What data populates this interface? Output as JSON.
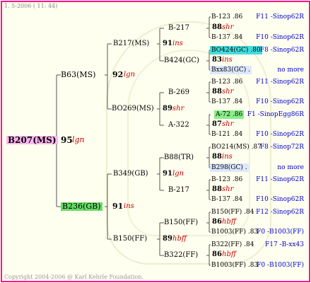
{
  "header": {
    "date": "1.  5-2006 ( 11: 44)"
  },
  "footer": {
    "copyright": "Copyright 2004-2006 @ Karl Kehrle Foundation."
  },
  "colors": {
    "border": "#ff1493",
    "root_bg": "#ffb6f0",
    "gb_bg": "#66dd66",
    "cyan_bg": "#44dddd",
    "green_bg": "#88ee88",
    "light_bg": "#dde8ff"
  },
  "root": {
    "name": "B207(MS)",
    "num": "95",
    "tag": "lgn"
  },
  "g1": {
    "top": {
      "name": "B63(MS)",
      "num": "92",
      "tag": "lgn"
    },
    "bottom": {
      "name": "B236(GB)",
      "num": "91",
      "tag": "ins"
    }
  },
  "g2": {
    "a": {
      "name": "B217(MS)",
      "num": "91",
      "tag": "ins"
    },
    "b": {
      "name": "BO269(MS)",
      "num": "89",
      "tag": "shr"
    },
    "c": {
      "name": "B349(GB)",
      "num": "91",
      "tag": "lgn"
    },
    "d": {
      "name": "B150(FF)",
      "num": "89",
      "tag": "hbff"
    }
  },
  "g3": {
    "a1": {
      "name": "B-217",
      "num": "88",
      "tag": "shr"
    },
    "a2": {
      "name": "B424(GC)",
      "num": "83",
      "tag": "ins"
    },
    "b1": {
      "name": "B-269",
      "num": "88",
      "tag": "shr"
    },
    "b2": {
      "name": "A-322",
      "num": "87",
      "tag": "shr"
    },
    "c1": {
      "name": "B88(TR)",
      "num": "88",
      "tag": "ins"
    },
    "c2": {
      "name": "B-217",
      "num": "88",
      "tag": "shr"
    },
    "d1": {
      "name": "B150(FF)",
      "num": "86",
      "tag": "hbff"
    },
    "d2": {
      "name": "B322(FF)",
      "num": "86",
      "tag": "hbff"
    }
  },
  "g4": [
    {
      "name": "B-123 .86",
      "ped": "F11 -Sinop62R"
    },
    {
      "name": "B-137 .84",
      "ped": "F10 -Sinop62R"
    },
    {
      "name": "BO424(GC) .80",
      "ped": "F8 -Sinop62R"
    },
    {
      "name": "Bxx83(GC) .",
      "ped": "no more"
    },
    {
      "name": "B-123 .86",
      "ped": "F11 -Sinop62R"
    },
    {
      "name": "B-137 .84",
      "ped": "F10 -Sinop62R"
    },
    {
      "name": "A-72 .86",
      "ped": "F1 -SinopEgg86R"
    },
    {
      "name": "B-121 .84",
      "ped": "F10 -Sinop62R"
    },
    {
      "name": "BO214(MS) .87",
      "ped": "F8 -Sinop72R"
    },
    {
      "name": "B298(GC) .",
      "ped": "no more"
    },
    {
      "name": "B-123 .86",
      "ped": "F11 -Sinop62R"
    },
    {
      "name": "B-137 .84",
      "ped": "F10 -Sinop62R"
    },
    {
      "name": "B150(FF) .84",
      "ped": "F12 -Sinop62R"
    },
    {
      "name": "B1003(FF) .83",
      "ped": "F0 -B1003(FF)"
    },
    {
      "name": "B322(FF) .84",
      "ped": "F17 -B-xx43"
    },
    {
      "name": "B1003(FF) .83",
      "ped": "F0 -B1003(FF)"
    }
  ]
}
